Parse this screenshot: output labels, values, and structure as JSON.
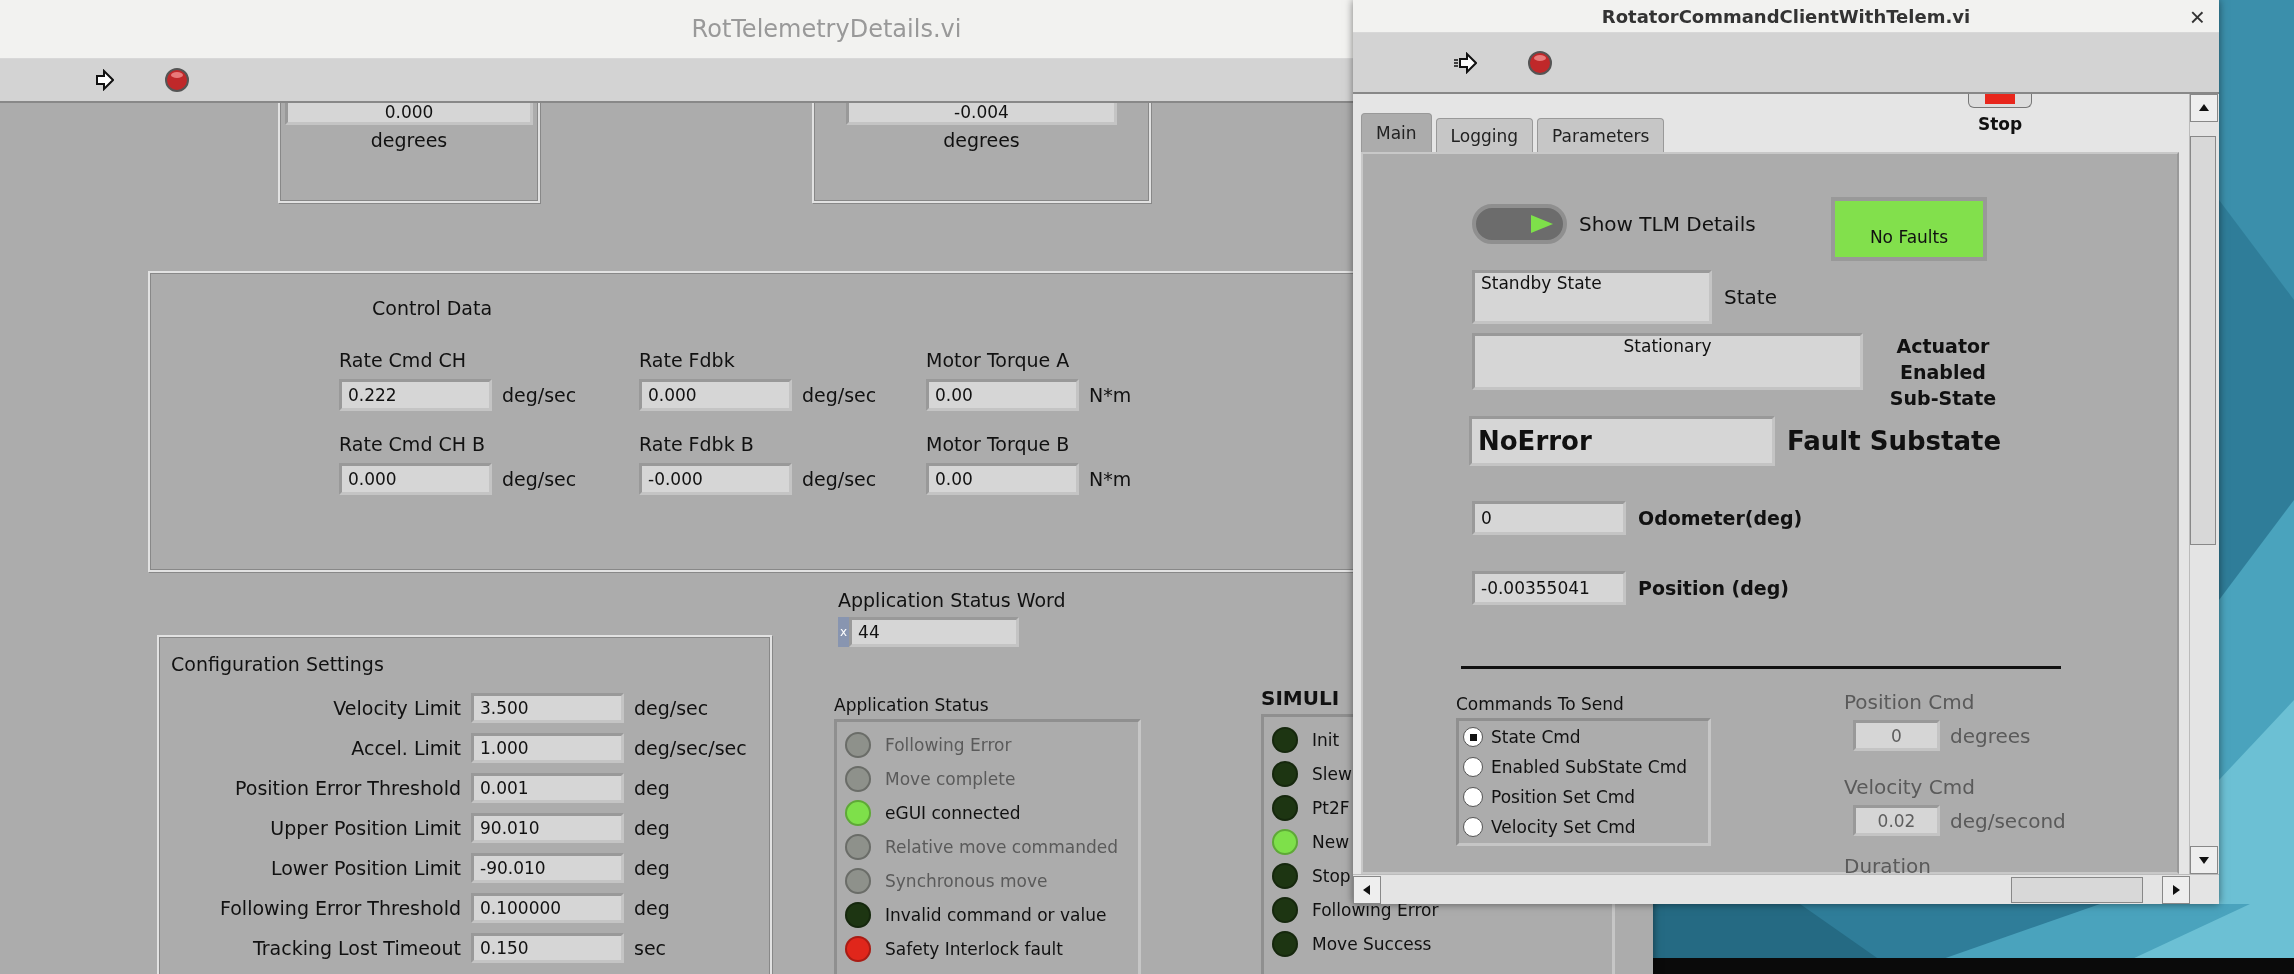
{
  "back_window": {
    "title": "RotTelemetryDetails.vi"
  },
  "readouts": [
    {
      "value": "0.000",
      "unit": "degrees"
    },
    {
      "value": "-0.004",
      "unit": "degrees"
    }
  ],
  "control_data": {
    "title": "Control Data",
    "items": [
      {
        "label": "Rate Cmd  CH",
        "value": "0.222",
        "unit": "deg/sec"
      },
      {
        "label": "Rate Fdbk",
        "value": "0.000",
        "unit": "deg/sec"
      },
      {
        "label": "Motor Torque  A",
        "value": "0.00",
        "unit": "N*m"
      },
      {
        "label": "Rate Cmd  CH B",
        "value": "0.000",
        "unit": "deg/sec"
      },
      {
        "label": "Rate Fdbk  B",
        "value": "-0.000",
        "unit": "deg/sec"
      },
      {
        "label": "Motor Torque  B",
        "value": "0.00",
        "unit": "N*m"
      }
    ]
  },
  "status_word": {
    "label": "Application Status Word",
    "radix": "x",
    "value": "44"
  },
  "config": {
    "title": "Configuration Settings",
    "rows": [
      {
        "label": "Velocity Limit",
        "value": "3.500",
        "unit": "deg/sec"
      },
      {
        "label": "Accel. Limit",
        "value": "1.000",
        "unit": "deg/sec/sec"
      },
      {
        "label": "Position Error Threshold",
        "value": "0.001",
        "unit": "deg"
      },
      {
        "label": "Upper Position Limit",
        "value": "90.010",
        "unit": "deg"
      },
      {
        "label": "Lower Position Limit",
        "value": "-90.010",
        "unit": "deg"
      },
      {
        "label": "Following Error Threshold",
        "value": "0.100000",
        "unit": "deg"
      },
      {
        "label": "Tracking Lost Timeout",
        "value": "0.150",
        "unit": "sec"
      }
    ]
  },
  "app_status": {
    "title": "Application Status",
    "leds": [
      {
        "label": "Following Error",
        "color": "#8e918b",
        "disabled": true
      },
      {
        "label": "Move complete",
        "color": "#8e918b",
        "disabled": true
      },
      {
        "label": "eGUI connected",
        "color": "#7ee04a",
        "disabled": false
      },
      {
        "label": "Relative move commanded",
        "color": "#8e918b",
        "disabled": true
      },
      {
        "label": "Synchronous move",
        "color": "#8e918b",
        "disabled": true
      },
      {
        "label": "Invalid command or value",
        "color": "#1d3512",
        "disabled": false
      },
      {
        "label": "Safety Interlock fault",
        "color": "#e0261b",
        "disabled": false
      }
    ]
  },
  "simulink": {
    "title": "SIMULI",
    "leds": [
      {
        "label": "Init",
        "color": "#1d3512"
      },
      {
        "label": "Slew",
        "color": "#1d3512"
      },
      {
        "label": "Pt2F",
        "color": "#1d3512"
      },
      {
        "label": "New",
        "color": "#7ee04a"
      },
      {
        "label": "Stop",
        "color": "#1d3512"
      },
      {
        "label": "Following Error",
        "color": "#1d3512"
      },
      {
        "label": "Move Success",
        "color": "#1d3512"
      }
    ]
  },
  "front_window": {
    "title": "RotatorCommandClientWithTelem.vi",
    "close": "×",
    "stop_button": {
      "label": "Stop"
    },
    "tabs": [
      {
        "label": "Main",
        "selected": true
      },
      {
        "label": "Logging",
        "selected": false
      },
      {
        "label": "Parameters",
        "selected": false
      }
    ],
    "toggle": {
      "label": "Show TLM Details",
      "on": true
    },
    "fault_indicator": {
      "label": "No Faults",
      "on": true
    },
    "state": {
      "value": "Standby State",
      "label": "State"
    },
    "substate": {
      "value": "Stationary",
      "label": "Actuator Enabled Sub-State"
    },
    "fault_substate": {
      "value": "NoError",
      "label": "Fault Substate"
    },
    "odometer": {
      "value": "0",
      "label": "Odometer(deg)"
    },
    "position": {
      "value": "-0.00355041",
      "label": "Position (deg)"
    },
    "commands": {
      "title": "Commands To Send",
      "options": [
        {
          "label": "State Cmd",
          "selected": true
        },
        {
          "label": "Enabled SubState Cmd",
          "selected": false
        },
        {
          "label": "Position Set Cmd",
          "selected": false
        },
        {
          "label": "Velocity Set Cmd",
          "selected": false
        }
      ]
    },
    "position_cmd": {
      "label": "Position Cmd",
      "value": "0",
      "unit": "degrees",
      "disabled": true
    },
    "velocity_cmd": {
      "label": "Velocity Cmd",
      "value": "0.02",
      "unit": "deg/second",
      "disabled": true
    },
    "duration": {
      "label": "Duration",
      "disabled": true
    }
  }
}
